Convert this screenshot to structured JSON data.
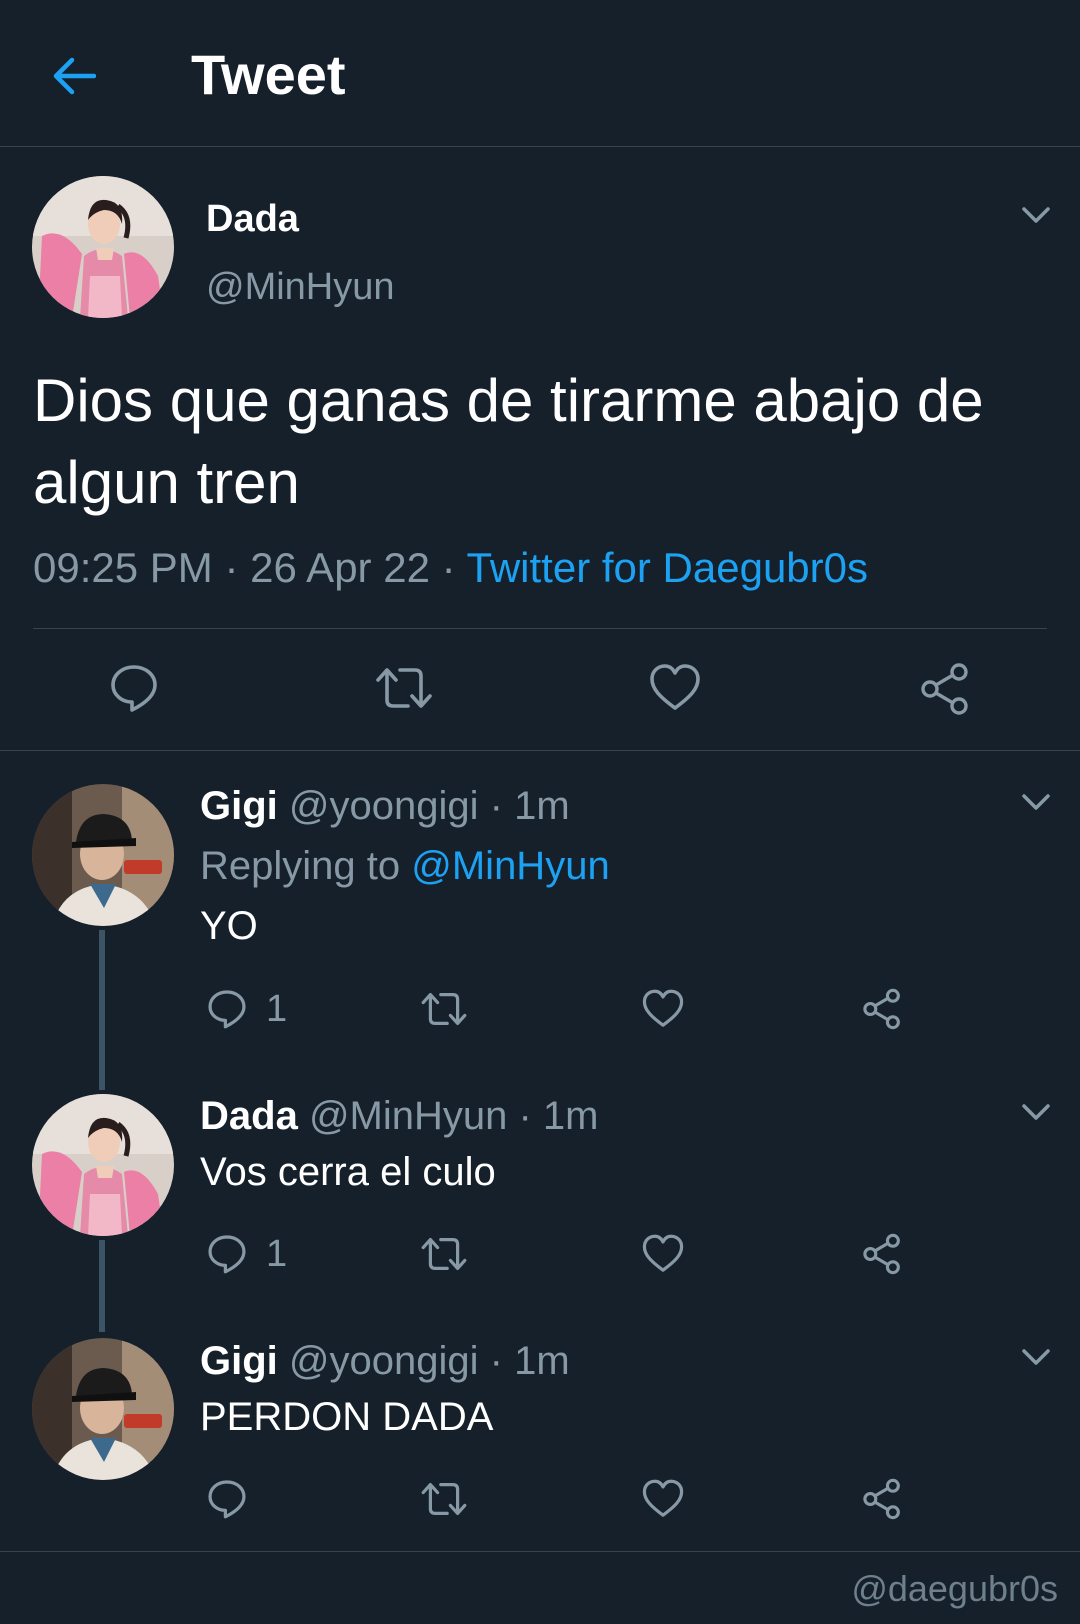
{
  "header": {
    "title": "Tweet",
    "back_icon": "arrow-left-icon"
  },
  "main_tweet": {
    "name": "Dada",
    "handle": "@MinHyun",
    "text": "Dios que ganas de tirarme abajo de algun tren",
    "time": "09:25 PM",
    "date": "26 Apr 22",
    "separator": " · ",
    "client": "Twitter for Daegubr0s"
  },
  "replies": [
    {
      "name": "Gigi",
      "handle": "@yoongigi",
      "time": "· 1m",
      "replying_label": "Replying to",
      "replying_mention": "@MinHyun",
      "text": "YO",
      "reply_count": "1"
    },
    {
      "name": "Dada",
      "handle": "@MinHyun",
      "time": "· 1m",
      "text": "Vos cerra el culo",
      "reply_count": "1"
    },
    {
      "name": "Gigi",
      "handle": "@yoongigi",
      "time": "· 1m",
      "text": "PERDON DADA"
    }
  ],
  "watermark": "@daegubr0s",
  "colors": {
    "background": "#15202b",
    "accent": "#1da1f2",
    "secondary_text": "#8899a6",
    "divider": "#38444d"
  }
}
